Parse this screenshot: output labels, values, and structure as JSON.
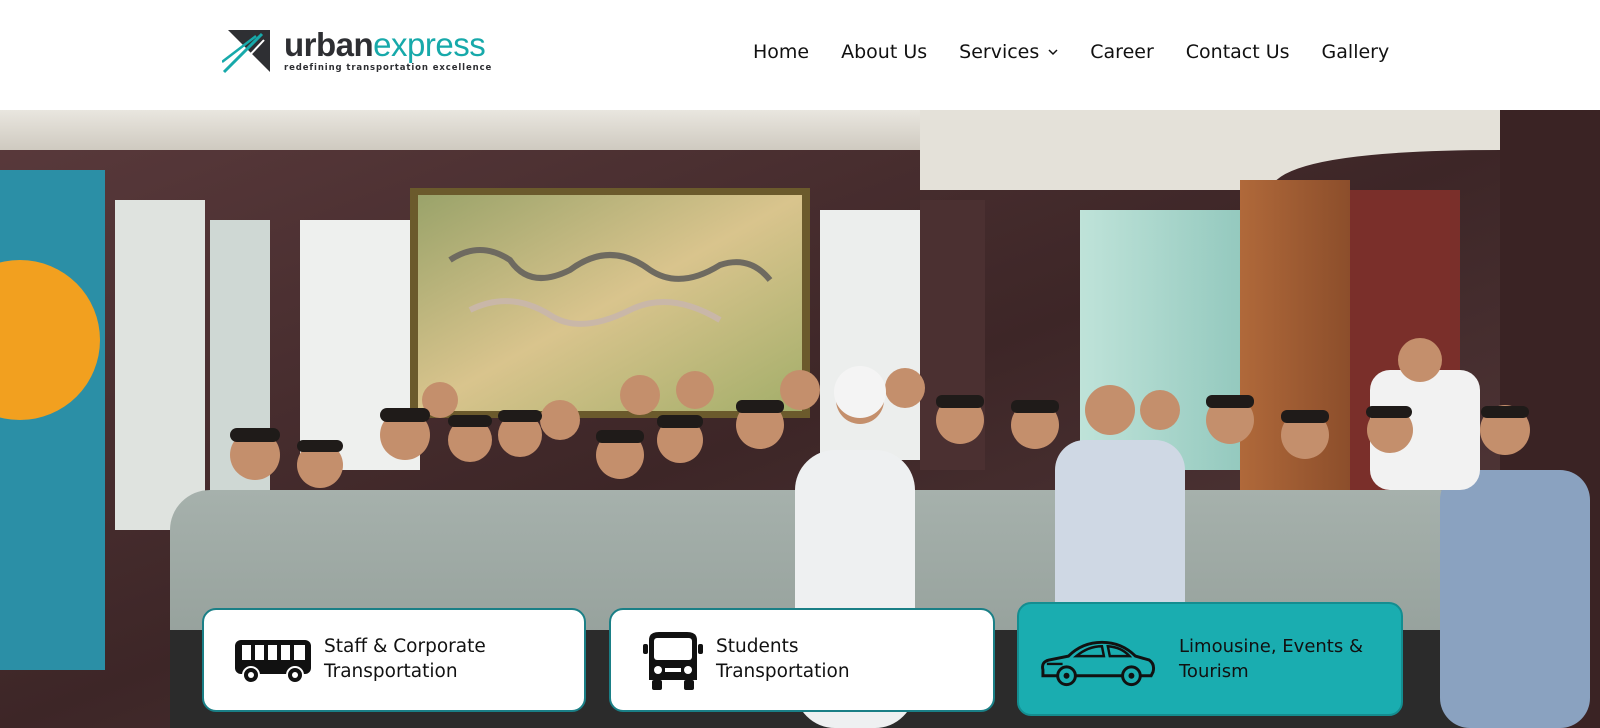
{
  "brand": {
    "name_part1": "urban",
    "name_part2": "express",
    "tagline": "redefining transportation excellence",
    "colors": {
      "dark": "#2e2f33",
      "teal": "#17a9aa"
    }
  },
  "nav": {
    "items": [
      {
        "label": "Home"
      },
      {
        "label": "About Us"
      },
      {
        "label": "Services",
        "has_dropdown": true
      },
      {
        "label": "Career"
      },
      {
        "label": "Contact Us"
      },
      {
        "label": "Gallery"
      }
    ]
  },
  "hero": {
    "image_alt": "Group photo of Urban Express team in uniforms"
  },
  "services": [
    {
      "line1": "Staff & Corporate",
      "line2": "Transportation",
      "icon": "bus-icon",
      "style": "white"
    },
    {
      "line1": "Students",
      "line2": "Transportation",
      "icon": "school-bus-icon",
      "style": "white"
    },
    {
      "line1": "Limousine, Events &",
      "line2": "Tourism",
      "icon": "car-icon",
      "style": "teal",
      "accent": "#1aadb0"
    }
  ]
}
